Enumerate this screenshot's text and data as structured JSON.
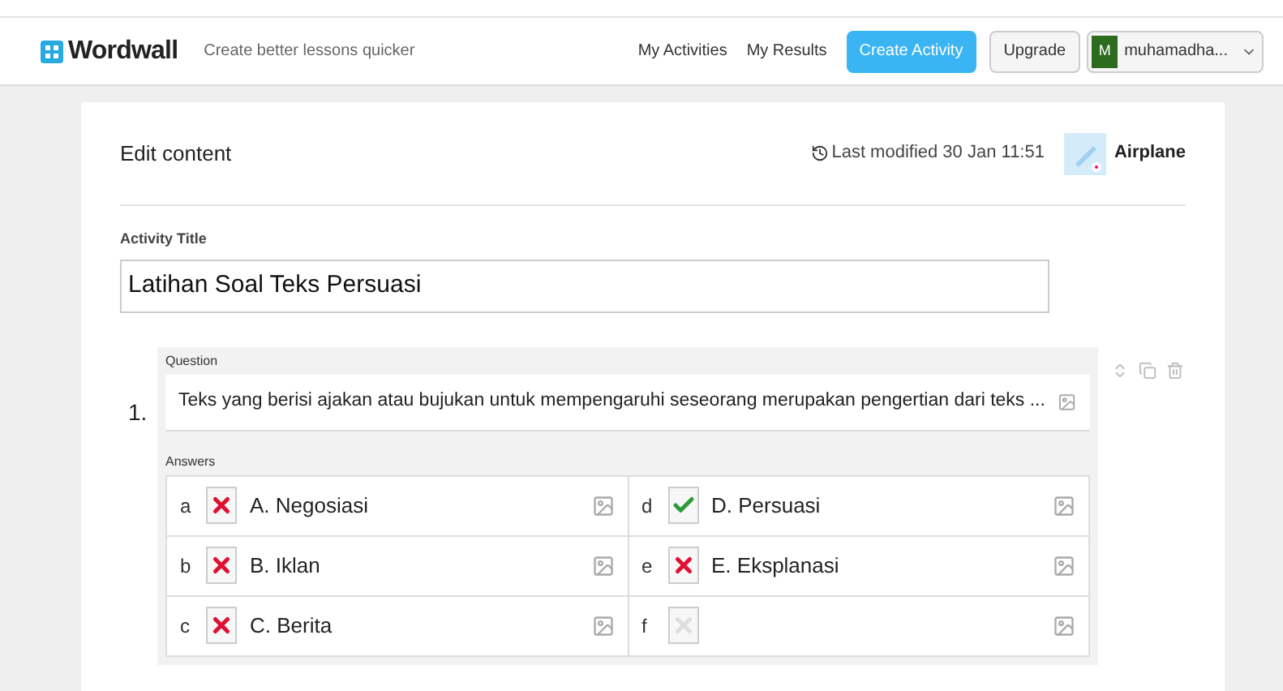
{
  "header": {
    "logo": "Wordwall",
    "tagline": "Create better lessons quicker",
    "nav": [
      "My Activities",
      "My Results"
    ],
    "create_button": "Create Activity",
    "upgrade_button": "Upgrade",
    "user": {
      "initial": "M",
      "name": "muhamadha..."
    }
  },
  "editor": {
    "title": "Edit content",
    "last_modified": "Last modified 30 Jan 11:51",
    "theme": "Airplane",
    "activity_title_label": "Activity Title",
    "activity_title": "Latihan Soal Teks Persuasi",
    "question": {
      "number": "1.",
      "label": "Question",
      "text": "Teks yang berisi ajakan atau bujukan untuk mempengaruhi seseorang merupakan pengertian dari teks ...",
      "answers_label": "Answers",
      "answers": [
        {
          "letter": "a",
          "kind": "wrong",
          "text": "A. Negosiasi"
        },
        {
          "letter": "b",
          "kind": "wrong",
          "text": "B. Iklan"
        },
        {
          "letter": "c",
          "kind": "wrong",
          "text": "C. Berita"
        },
        {
          "letter": "d",
          "kind": "correct",
          "text": "D. Persuasi"
        },
        {
          "letter": "e",
          "kind": "wrong",
          "text": "E. Eksplanasi"
        },
        {
          "letter": "f",
          "kind": "blank"
        }
      ]
    }
  }
}
